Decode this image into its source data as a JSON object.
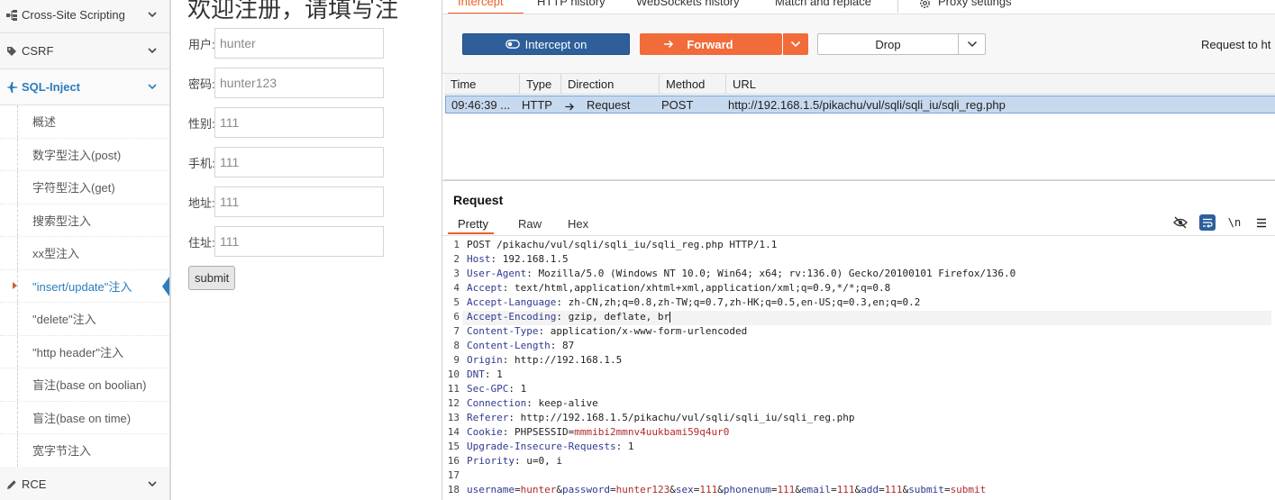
{
  "sidebar": {
    "top_items": [
      {
        "label": "Cross-Site Scripting",
        "icon": "sitemap-icon"
      },
      {
        "label": "CSRF",
        "icon": "tag-icon"
      },
      {
        "label": "SQL-Inject",
        "icon": "plane-icon"
      }
    ],
    "sub_items": [
      "概述",
      "数字型注入(post)",
      "字符型注入(get)",
      "搜索型注入",
      "xx型注入",
      "\"insert/update\"注入",
      "\"delete\"注入",
      "\"http header\"注入",
      "盲注(base on boolian)",
      "盲注(base on time)",
      "宽字节注入"
    ],
    "current_sub_index": 5,
    "bottom_item": {
      "label": "RCE",
      "icon": "pencil-icon"
    },
    "accent_color": "#2b7dbc"
  },
  "form": {
    "title": "欢迎注册，请填写注",
    "fields": [
      {
        "label": "用户:",
        "value": "hunter"
      },
      {
        "label": "密码:",
        "value": "hunter123"
      },
      {
        "label": "性别:",
        "value": "111"
      },
      {
        "label": "手机:",
        "value": "111"
      },
      {
        "label": "地址:",
        "value": "111"
      },
      {
        "label": "住址:",
        "value": "111"
      }
    ],
    "submit_label": "submit"
  },
  "burp": {
    "tabs": [
      "Intercept",
      "HTTP history",
      "WebSockets history",
      "Match and replace",
      "Proxy settings"
    ],
    "active_tab": "Intercept",
    "accent_color": "#e8602c",
    "toolbar": {
      "intercept_label": "Intercept on",
      "forward_label": "Forward",
      "drop_label": "Drop",
      "request_to": "Request to ht"
    },
    "table": {
      "columns": [
        "Time",
        "Type",
        "Direction",
        "Method",
        "URL"
      ],
      "rows": [
        {
          "time": "09:46:39 ...",
          "type": "HTTP",
          "direction": "Request",
          "method": "POST",
          "url": "http://192.168.1.5/pikachu/vul/sqli/sqli_iu/sqli_reg.php"
        }
      ]
    },
    "request": {
      "title": "Request",
      "view_tabs": [
        "Pretty",
        "Raw",
        "Hex"
      ],
      "active_view": "Pretty",
      "newline_toggle": "\\n",
      "lines": [
        {
          "n": "1",
          "key": "",
          "value": "POST /pikachu/vul/sqli/sqli_iu/sqli_reg.php HTTP/1.1"
        },
        {
          "n": "2",
          "key": "Host",
          "value": "192.168.1.5"
        },
        {
          "n": "3",
          "key": "User-Agent",
          "value": "Mozilla/5.0 (Windows NT 10.0; Win64; x64; rv:136.0) Gecko/20100101 Firefox/136.0"
        },
        {
          "n": "4",
          "key": "Accept",
          "value": "text/html,application/xhtml+xml,application/xml;q=0.9,*/*;q=0.8"
        },
        {
          "n": "5",
          "key": "Accept-Language",
          "value": "zh-CN,zh;q=0.8,zh-TW;q=0.7,zh-HK;q=0.5,en-US;q=0.3,en;q=0.2"
        },
        {
          "n": "6",
          "key": "Accept-Encoding",
          "value": "gzip, deflate, br"
        },
        {
          "n": "7",
          "key": "Content-Type",
          "value": "application/x-www-form-urlencoded"
        },
        {
          "n": "8",
          "key": "Content-Length",
          "value": "87"
        },
        {
          "n": "9",
          "key": "Origin",
          "value": "http://192.168.1.5"
        },
        {
          "n": "10",
          "key": "DNT",
          "value": "1"
        },
        {
          "n": "11",
          "key": "Sec-GPC",
          "value": "1"
        },
        {
          "n": "12",
          "key": "Connection",
          "value": "keep-alive"
        },
        {
          "n": "13",
          "key": "Referer",
          "value": "http://192.168.1.5/pikachu/vul/sqli/sqli_iu/sqli_reg.php"
        },
        {
          "n": "14",
          "key": "Cookie",
          "value": "PHPSESSID=",
          "cookie_value": "mmmibi2mmnv4uukbami59q4ur0"
        },
        {
          "n": "15",
          "key": "Upgrade-Insecure-Requests",
          "value": "1"
        },
        {
          "n": "16",
          "key": "Priority",
          "value": "u=0, i"
        },
        {
          "n": "17",
          "key": "",
          "value": ""
        }
      ],
      "body_line_number": "18",
      "body_params": [
        {
          "k": "username",
          "v": "hunter"
        },
        {
          "k": "password",
          "v": "hunter123"
        },
        {
          "k": "sex",
          "v": "111"
        },
        {
          "k": "phonenum",
          "v": "111"
        },
        {
          "k": "email",
          "v": "111"
        },
        {
          "k": "add",
          "v": "111"
        },
        {
          "k": "submit",
          "v": "submit"
        }
      ]
    }
  }
}
